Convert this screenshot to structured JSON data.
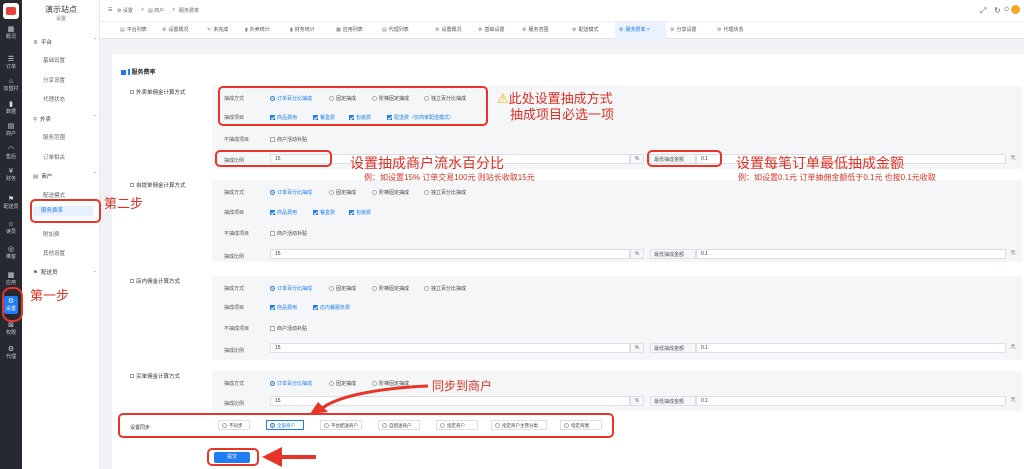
{
  "rail": {
    "items": [
      {
        "label": "概况",
        "icon": "dashboard-icon"
      },
      {
        "label": "订单",
        "icon": "list-icon"
      },
      {
        "label": "加盟村",
        "icon": "store-icon"
      },
      {
        "label": "数据",
        "icon": "chart-icon"
      },
      {
        "label": "商户",
        "icon": "shop-icon"
      },
      {
        "label": "售后",
        "icon": "headset-icon"
      },
      {
        "label": "财务",
        "icon": "money-icon"
      },
      {
        "label": "配送员",
        "icon": "rider-icon"
      },
      {
        "label": "读员",
        "icon": "user-icon"
      },
      {
        "label": "推客",
        "icon": "share-icon"
      },
      {
        "label": "应用",
        "icon": "apps-icon"
      },
      {
        "label": "设置",
        "icon": "gear-icon"
      },
      {
        "label": "权限",
        "icon": "lock-icon"
      },
      {
        "label": "代理",
        "icon": "agent-icon"
      }
    ]
  },
  "side": {
    "site_name": "演示站点",
    "site_sub": "设置",
    "groups": [
      {
        "label": "平台",
        "items": [
          "基础设置",
          "分享设置",
          "代理状态"
        ]
      },
      {
        "label": "外卖",
        "items": [
          "服务范围",
          "订单相关"
        ]
      },
      {
        "label": "商户",
        "items": [
          "配送模式",
          "服务费率",
          "附加费",
          "其他设置"
        ]
      },
      {
        "label": "配送员",
        "items": []
      }
    ]
  },
  "topbar": {
    "crumbs": [
      "设置",
      ">",
      "商户",
      ">",
      "服务费率"
    ],
    "icons": [
      "expand-icon",
      "refresh-icon",
      "power-icon"
    ]
  },
  "tabs": [
    {
      "label": "平台列表",
      "icon": "list-icon"
    },
    {
      "label": "设置概况",
      "icon": "gear-icon"
    },
    {
      "label": "未完成",
      "icon": "edit-icon"
    },
    {
      "label": "外卖统计",
      "icon": "chart-icon"
    },
    {
      "label": "财务统计",
      "icon": "chart-icon"
    },
    {
      "label": "应用列表",
      "icon": "apps-icon"
    },
    {
      "label": "代理列表",
      "icon": "list-icon"
    },
    {
      "label": "设置概况",
      "icon": "gear-icon"
    },
    {
      "label": "基础设置",
      "icon": "gear-icon"
    },
    {
      "label": "服务范围",
      "icon": "gear-icon"
    },
    {
      "label": "配送模式",
      "icon": "gear-icon"
    },
    {
      "label": "服务费率",
      "icon": "gear-icon",
      "close": "×"
    },
    {
      "label": "分享设置",
      "icon": "gear-icon"
    },
    {
      "label": "代理状态",
      "icon": "gear-icon"
    }
  ],
  "section": {
    "title": "服务费率"
  },
  "blocks": [
    {
      "mode_label": "外卖单佣金计算方式",
      "method_label": "抽成方式",
      "methods": [
        "订单百分比抽成",
        "固定抽成",
        "阶梯固定抽成",
        "独立百分比抽成"
      ],
      "items_label": "抽成项目",
      "items": [
        "商品费用",
        "餐盒费",
        "包装费",
        "配送费（仅商家配送模式）"
      ],
      "exclude_label": "不抽成项目",
      "exclude_item": "商户活动补贴",
      "ratio_label": "抽成比例",
      "ratio_value": "15",
      "ratio_suffix": "%",
      "min_label": "最低抽成金额",
      "min_value": "0.1",
      "min_suffix": "元"
    },
    {
      "mode_label": "自提单佣金计算方式",
      "method_label": "抽成方式",
      "methods": [
        "订单百分比抽成",
        "固定抽成",
        "阶梯固定抽成",
        "独立百分比抽成"
      ],
      "items_label": "抽成项目",
      "items": [
        "商品费用",
        "餐盒费",
        "包装费"
      ],
      "exclude_label": "不抽成项目",
      "exclude_item": "商户活动补贴",
      "ratio_label": "抽成比例",
      "ratio_value": "15",
      "ratio_suffix": "%",
      "min_label": "最低抽成金额",
      "min_value": "0.1",
      "min_suffix": "元"
    },
    {
      "mode_label": "店内佣金计算方式",
      "method_label": "抽成方式",
      "methods": [
        "订单百分比抽成",
        "固定抽成",
        "阶梯固定抽成",
        "独立百分比抽成"
      ],
      "items_label": "抽成项目",
      "items": [
        "商品费用",
        "店内餐服务费"
      ],
      "exclude_label": "不抽成项目",
      "exclude_item": "商户活动补贴",
      "ratio_label": "抽成比例",
      "ratio_value": "15",
      "ratio_suffix": "%",
      "min_label": "最低抽成金额",
      "min_value": "0.1",
      "min_suffix": "元"
    },
    {
      "mode_label": "买单佣金计算方式",
      "method_label": "抽成方式",
      "methods": [
        "订单百分比抽成",
        "固定抽成",
        "阶梯固定抽成"
      ],
      "ratio_label": "抽成比例",
      "ratio_value": "15",
      "ratio_suffix": "%",
      "min_label": "最低抽成金额",
      "min_value": "0.1",
      "min_suffix": "元"
    }
  ],
  "sync": {
    "label": "设置同步",
    "options": [
      "不同步",
      "全部商户",
      "平台配送商户",
      "自配送商户",
      "指定商户",
      "指定商户主营分类",
      "指定商圈"
    ],
    "selected": "全部商户"
  },
  "submit_label": "提交",
  "annotations": {
    "a1_line1": "此处设置抽成方式",
    "a1_line2": "抽成项目必选一项",
    "a2_title": "设置抽成商户流水百分比",
    "a2_sub": "例：如设置15% 订单交易100元 则站长收取15元",
    "a3_title": "设置每笔订单最低抽成金额",
    "a3_sub": "例：如设置0.1元 订单抽佣金额低于0.1元 也按0.1元收取",
    "step1": "第一步",
    "step2": "第二步",
    "sync_note": "同步到商户"
  },
  "colors": {
    "accent": "#1f7cf2",
    "annotation": "#e8352a",
    "rail": "#26292f"
  }
}
